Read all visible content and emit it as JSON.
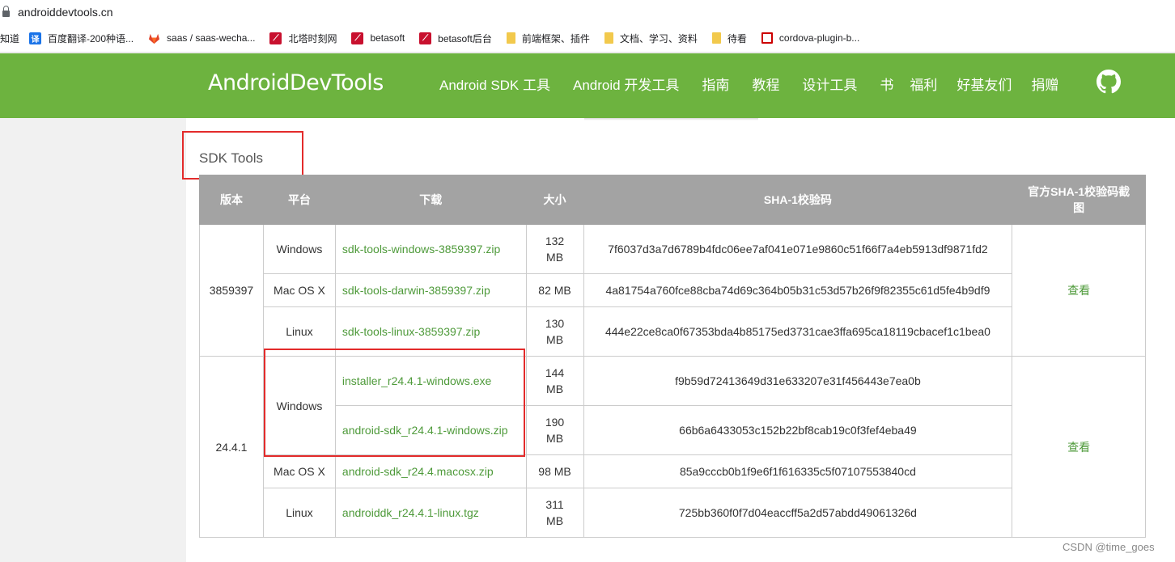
{
  "browser": {
    "url": "androiddevtools.cn",
    "bookmarks": [
      {
        "icon": "text",
        "label": "知道"
      },
      {
        "icon": "translate-icon",
        "label": "百度翻译-200种语..."
      },
      {
        "icon": "gitlab-icon",
        "label": "saas / saas-wecha..."
      },
      {
        "icon": "red-logo-icon",
        "label": "北塔时刻网"
      },
      {
        "icon": "red-logo-icon",
        "label": "betasoft"
      },
      {
        "icon": "red-logo-icon",
        "label": "betasoft后台"
      },
      {
        "icon": "folder-icon",
        "label": "前端框架、插件"
      },
      {
        "icon": "folder-icon",
        "label": "文档、学习、资料"
      },
      {
        "icon": "folder-icon",
        "label": "待看"
      },
      {
        "icon": "red-box-icon",
        "label": "cordova-plugin-b..."
      }
    ]
  },
  "site": {
    "logo": "AndroidDevTools",
    "nav": [
      "Android SDK 工具",
      "Android 开发工具",
      "指南",
      "教程",
      "设计工具",
      "书",
      "福利",
      "好基友们",
      "捐赠"
    ]
  },
  "section": {
    "title": "SDK Tools"
  },
  "table": {
    "headers": [
      "版本",
      "平台",
      "下载",
      "大小",
      "SHA-1校验码",
      "官方SHA-1校验码截图"
    ],
    "groups": [
      {
        "version": "3859397",
        "screenshot_link": "查看",
        "rows": [
          {
            "platform": "Windows",
            "file": "sdk-tools-windows-3859397.zip",
            "size": "132 MB",
            "sha1": "7f6037d3a7d6789b4fdc06ee7af041e071e9860c51f66f7a4eb5913df9871fd2"
          },
          {
            "platform": "Mac OS X",
            "file": "sdk-tools-darwin-3859397.zip",
            "size": "82 MB",
            "sha1": "4a81754a760fce88cba74d69c364b05b31c53d57b26f9f82355c61d5fe4b9df9"
          },
          {
            "platform": "Linux",
            "file": "sdk-tools-linux-3859397.zip",
            "size": "130 MB",
            "sha1": "444e22ce8ca0f67353bda4b85175ed3731cae3ffa695ca18119cbacef1c1bea0"
          }
        ]
      },
      {
        "version": "24.4.1",
        "screenshot_link": "查看",
        "rows": [
          {
            "platform": "Windows",
            "file": "installer_r24.4.1-windows.exe",
            "size": "144 MB",
            "sha1": "f9b59d72413649d31e633207e31f456443e7ea0b"
          },
          {
            "platform": "",
            "file": "android-sdk_r24.4.1-windows.zip",
            "size": "190 MB",
            "sha1": "66b6a6433053c152b22bf8cab19c0f3fef4eba49"
          },
          {
            "platform": "Mac OS X",
            "file": "android-sdk_r24.4.macosx.zip",
            "size": "98 MB",
            "sha1": "85a9cccb0b1f9e6f1f616335c5f07107553840cd"
          },
          {
            "platform": "Linux",
            "file": "androiddk_r24.4.1-linux.tgz",
            "size": "311 MB",
            "sha1": "725bb360f0f7d04eaccff5a2d57abdd49061326d"
          }
        ]
      }
    ]
  },
  "watermark": "CSDN @time_goes",
  "colors": {
    "header_green": "#6db33f",
    "link_green": "#4e9a3a",
    "table_header_gray": "#a3a3a3",
    "highlight_red": "#e32b2b"
  }
}
